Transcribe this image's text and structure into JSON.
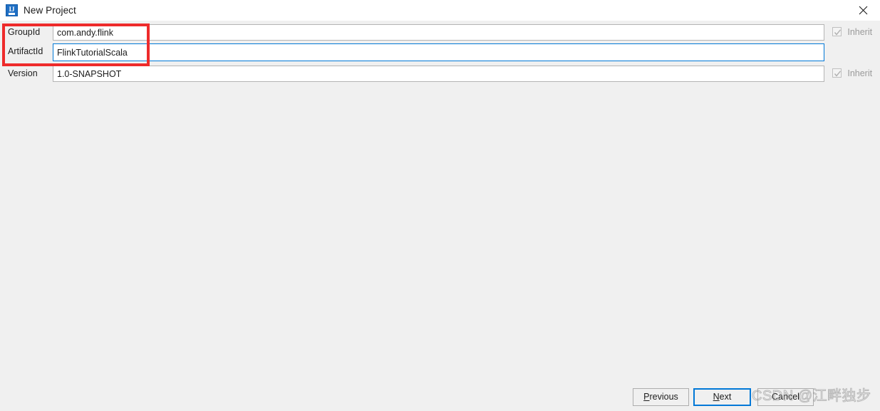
{
  "window": {
    "title": "New Project",
    "app_icon": "intellij-idea-icon",
    "icon_letters": "IJ",
    "close_icon": "close-icon",
    "background_color": "#f0f0f0"
  },
  "form": {
    "rows": [
      {
        "label": "GroupId",
        "value": "com.andy.flink",
        "focused": false,
        "inherit": {
          "label": "Inherit",
          "checked": true,
          "enabled": false
        }
      },
      {
        "label": "ArtifactId",
        "value": "FlinkTutorialScala",
        "focused": true,
        "inherit": null
      },
      {
        "label": "Version",
        "value": "1.0-SNAPSHOT",
        "focused": false,
        "inherit": {
          "label": "Inherit",
          "checked": true,
          "enabled": false
        }
      }
    ]
  },
  "annotation": {
    "type": "red-rectangle-highlight",
    "color": "#ee2b2b"
  },
  "footer": {
    "previous": {
      "label": "Previous",
      "mnemonic": "P"
    },
    "next": {
      "label": "Next",
      "mnemonic": "N",
      "focused": true,
      "accent_color": "#0078d7"
    },
    "cancel": {
      "label": "Cancel",
      "mnemonic": ""
    }
  },
  "watermark": {
    "text": "CSDN @江畔独步"
  }
}
